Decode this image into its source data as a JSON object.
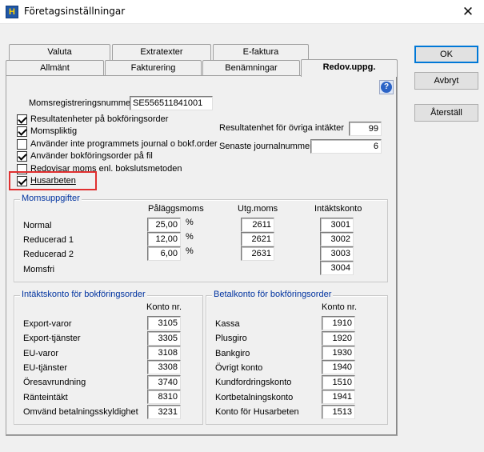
{
  "window": {
    "title": "Företagsinställningar",
    "close": "✕"
  },
  "tabs": {
    "row1": [
      "Valuta",
      "Extratexter",
      "E-faktura"
    ],
    "row2": [
      "Allmänt",
      "Fakturering",
      "Benämningar",
      "Redov.uppg."
    ],
    "active": "Redov.uppg."
  },
  "buttons": {
    "ok": "OK",
    "cancel": "Avbryt",
    "reset": "Återställ"
  },
  "help": "?",
  "vat_reg": {
    "label": "Momsregistreringsnummer",
    "value": "SE556511841001"
  },
  "checkboxes": [
    {
      "label": "Resultatenheter på bokföringsorder",
      "checked": true
    },
    {
      "label": "Momspliktig",
      "checked": true
    },
    {
      "label": "Använder inte programmets journal o bokf.order",
      "checked": false
    },
    {
      "label": "Använder bokföringsorder på fil",
      "checked": true
    },
    {
      "label": "Redovisar moms enl. bokslutsmetoden",
      "checked": false
    },
    {
      "label": "Husarbeten",
      "checked": true
    }
  ],
  "right_fields": [
    {
      "label": "Resultatenhet för övriga intäkter",
      "value": "99"
    },
    {
      "label": "Senaste journalnummer",
      "value": "6"
    }
  ],
  "moms": {
    "title": "Momsuppgifter",
    "headers": [
      "Påläggsmoms",
      "Utg.moms",
      "Intäktskonto"
    ],
    "pct": "%",
    "rows": [
      {
        "label": "Normal",
        "rate": "25,00",
        "utg": "2611",
        "konto": "3001"
      },
      {
        "label": "Reducerad  1",
        "rate": "12,00",
        "utg": "2621",
        "konto": "3002"
      },
      {
        "label": "Reducerad 2",
        "rate": "6,00",
        "utg": "2631",
        "konto": "3003"
      },
      {
        "label": "Momsfri",
        "konto": "3004"
      }
    ]
  },
  "intakt": {
    "title": "Intäktskonto för bokföringsorder",
    "header": "Konto nr.",
    "rows": [
      {
        "label": "Export-varor",
        "value": "3105"
      },
      {
        "label": "Export-tjänster",
        "value": "3305"
      },
      {
        "label": "EU-varor",
        "value": "3108"
      },
      {
        "label": "EU-tjänster",
        "value": "3308"
      },
      {
        "label": "Öresavrundning",
        "value": "3740"
      },
      {
        "label": "Ränteintäkt",
        "value": "8310"
      },
      {
        "label": "Omvänd betalningsskyldighet",
        "value": "3231"
      }
    ]
  },
  "betal": {
    "title": "Betalkonto för bokföringsorder",
    "header": "Konto nr.",
    "rows": [
      {
        "label": "Kassa",
        "value": "1910"
      },
      {
        "label": "Plusgiro",
        "value": "1920"
      },
      {
        "label": "Bankgiro",
        "value": "1930"
      },
      {
        "label": "Övrigt konto",
        "value": "1940"
      },
      {
        "label": "Kundfordringskonto",
        "value": "1510"
      },
      {
        "label": "Kortbetalningskonto",
        "value": "1941"
      },
      {
        "label": "Konto för Husarbeten",
        "value": "1513"
      }
    ]
  },
  "colors": {
    "group_title": "#0033a0",
    "highlight": "#e03030"
  }
}
